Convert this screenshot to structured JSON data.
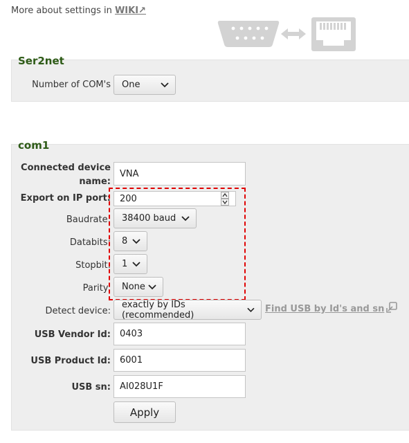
{
  "header": {
    "wiki_text": "More about settings in",
    "wiki_link": "WIKI↗"
  },
  "ser2net": {
    "title": "Ser2net",
    "num_com_label": "Number of COM's",
    "num_com_value": "One"
  },
  "com1": {
    "title": "com1",
    "device_name_label_line1": "Connected device",
    "device_name_label_line2": "name:",
    "device_name_value": "VNA",
    "export_port_label": "Export on IP port:",
    "export_port_value": "200",
    "baudrate_label": "Baudrate:",
    "baudrate_value": "38400 baud",
    "databits_label": "Databits:",
    "databits_value": "8",
    "stopbit_label": "Stopbit:",
    "stopbit_value": "1",
    "parity_label": "Parity:",
    "parity_value": "None",
    "detect_label": "Detect device:",
    "detect_value": "exactly by IDs (recommended)",
    "find_usb_link": "Find USB by Id's and sn",
    "vendor_label": "USB Vendor Id:",
    "vendor_value": "0403",
    "product_label": "USB Product Id:",
    "product_value": "6001",
    "sn_label": "USB sn:",
    "sn_value": "AI028U1F",
    "apply_label": "Apply"
  },
  "icons": {
    "serial": "db9-serial-icon",
    "arrow": "double-arrow-icon",
    "ethernet": "rj45-ethernet-icon",
    "find": "external-popup-icon"
  }
}
